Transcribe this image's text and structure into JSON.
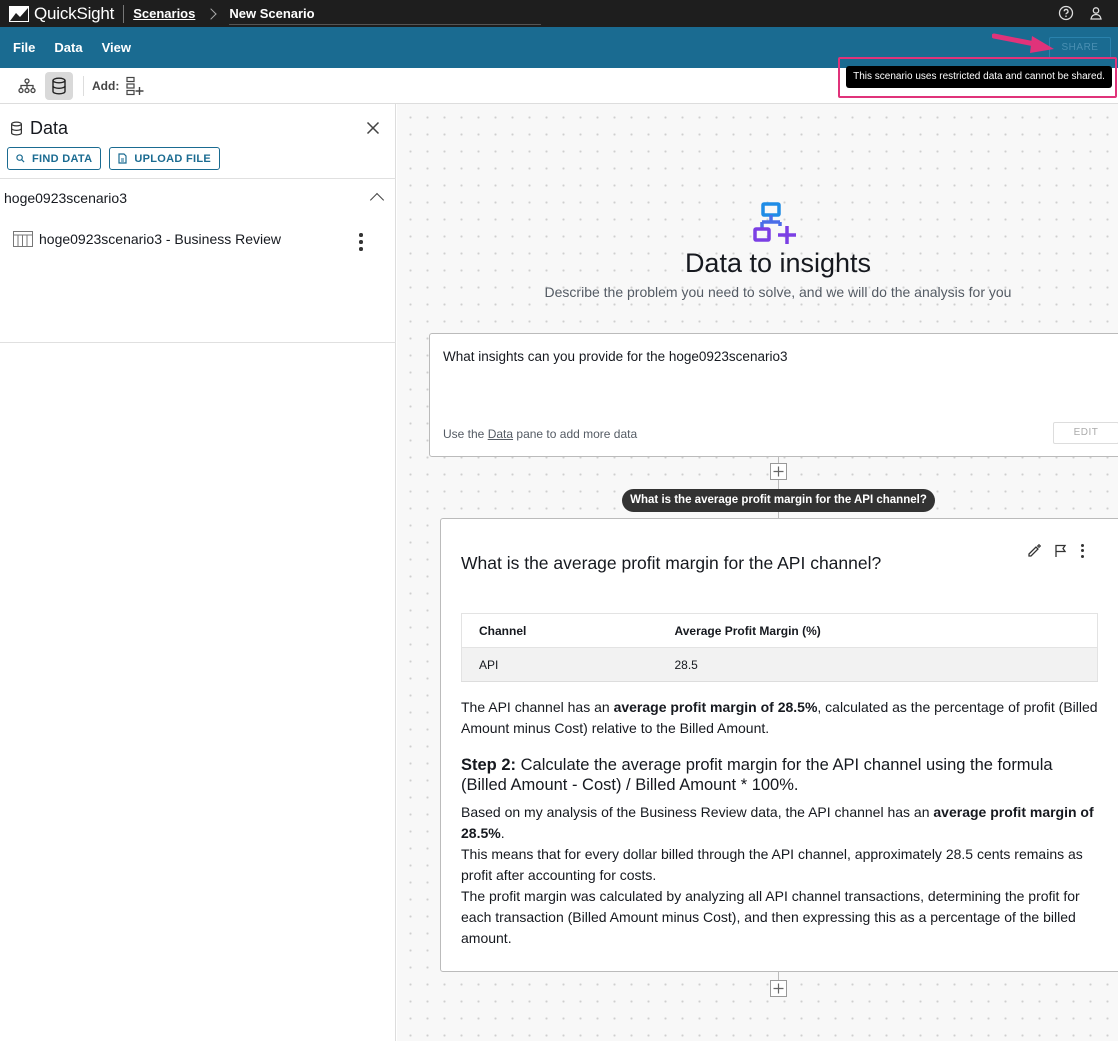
{
  "topbar": {
    "logo_text": "QuickSight",
    "breadcrumb_link": "Scenarios",
    "breadcrumb_current": "New Scenario"
  },
  "menu": {
    "items": [
      "File",
      "Data",
      "View"
    ],
    "share_label": "SHARE"
  },
  "toolbar": {
    "add_label": "Add:"
  },
  "tooltip": {
    "text": "This scenario uses restricted data and cannot be shared."
  },
  "data_pane": {
    "title": "Data",
    "find_data_label": "FIND DATA",
    "upload_file_label": "UPLOAD FILE",
    "dataset_name": "hoge0923scenario3",
    "dataset_item": "hoge0923scenario3 - Business Review"
  },
  "hero": {
    "title": "Data to insights",
    "subtitle": "Describe the problem you need to solve, and we will do the analysis for you"
  },
  "prompt": {
    "text": "What insights can you provide for the hoge0923scenario3",
    "hint_before": "Use the ",
    "hint_link": "Data",
    "hint_after": " pane to add more data",
    "edit_label": "EDIT"
  },
  "question_pill": "What is the average profit margin for the API channel?",
  "answer": {
    "title": "What is the average profit margin for the API channel?",
    "table": {
      "headers": [
        "Channel",
        "Average Profit Margin (%)"
      ],
      "rows": [
        [
          "API",
          "28.5"
        ]
      ]
    },
    "summary_before": "The API channel has an ",
    "summary_bold": "average profit margin of 28.5%",
    "summary_after": ", calculated as the percentage of profit (Billed Amount minus Cost) relative to the Billed Amount.",
    "step_label": "Step 2:",
    "step_text": " Calculate the average profit margin for the API channel using the formula (Billed Amount - Cost) / Billed Amount * 100%.",
    "detail_1_before": "Based on my analysis of the Business Review data, the API channel has an ",
    "detail_1_bold": "average profit margin of 28.5%",
    "detail_1_after": ".",
    "detail_2": "This means that for every dollar billed through the API channel, approximately 28.5 cents remains as profit after accounting for costs.",
    "detail_3": "The profit margin was calculated by analyzing all API channel transactions, determining the profit for each transaction (Billed Amount minus Cost), and then expressing this as a percentage of the billed amount."
  },
  "colors": {
    "menubar": "#1a6b91",
    "accent_pink": "#e0337a",
    "hero_icon_primary": "#1f8ce6",
    "hero_icon_secondary": "#7b3fe4"
  }
}
